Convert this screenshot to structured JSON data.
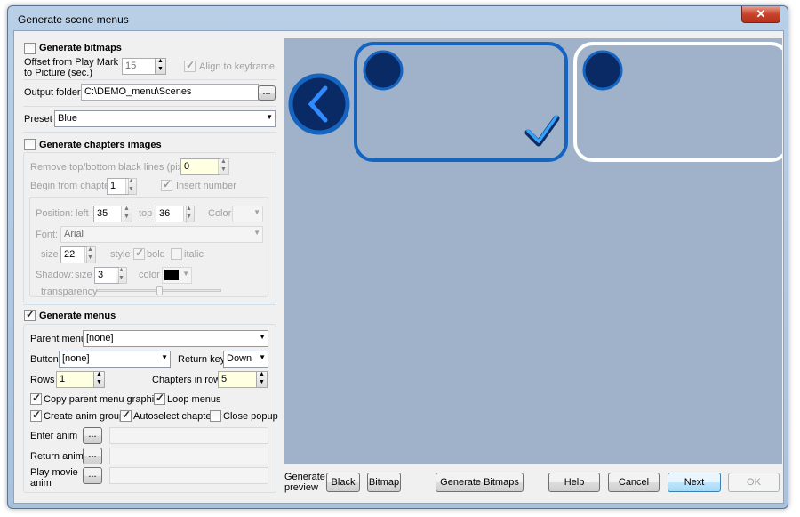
{
  "window": {
    "title": "Generate scene menus",
    "close_glyph": "✕"
  },
  "bitmaps": {
    "label": "Generate bitmaps",
    "checked": false,
    "offset_label": "Offset from Play Mark to Picture (sec.)",
    "offset_value": "15",
    "align_label": "Align to keyframe",
    "align_checked": true
  },
  "output": {
    "label": "Output folder",
    "value": "C:\\DEMO_menu\\Scenes",
    "browse": "..."
  },
  "preset": {
    "label": "Preset",
    "value": "Blue"
  },
  "chapters": {
    "label": "Generate chapters images",
    "checked": false,
    "remove_label": "Remove top/bottom black lines (pixels)",
    "remove_value": "0",
    "begin_label": "Begin from chapter",
    "begin_value": "1",
    "insert_label": "Insert number",
    "insert_checked": true,
    "position_label": "Position:",
    "left_label": "left",
    "left_value": "35",
    "top_label": "top",
    "top_value": "36",
    "color_label": "Color",
    "font_label": "Font:",
    "font_value": "Arial",
    "size_label": "size",
    "size_value": "22",
    "style_label": "style",
    "bold_label": "bold",
    "bold_checked": true,
    "italic_label": "italic",
    "italic_checked": false,
    "shadow_label": "Shadow:",
    "shadow_size_label": "size",
    "shadow_size_value": "3",
    "shadow_color_label": "color",
    "shadow_color": "#000000",
    "transparency_label": "transparency",
    "transparency_level": 0.5
  },
  "menus": {
    "label": "Generate menus",
    "checked": true,
    "parent_label": "Parent menu",
    "parent_value": "[none]",
    "button_label": "Button",
    "button_value": "[none]",
    "return_label": "Return key",
    "return_value": "Down",
    "rows_label": "Rows",
    "rows_value": "1",
    "chapters_row_label": "Chapters in row",
    "chapters_row_value": "5",
    "copy_label": "Copy parent menu graphics",
    "copy_checked": true,
    "loop_label": "Loop menus",
    "loop_checked": true,
    "anim_group_label": "Create anim group",
    "anim_group_checked": true,
    "autoselect_label": "Autoselect chapter",
    "autoselect_checked": true,
    "close_popup_label": "Close popup",
    "close_popup_checked": false,
    "enter_anim_label": "Enter anim",
    "return_anim_label": "Return anim",
    "play_movie_label": "Play movie anim",
    "browse": "..."
  },
  "footer": {
    "preview_label": "Generate preview",
    "black": "Black",
    "bitmap": "Bitmap",
    "gen_bitmaps": "Generate Bitmaps",
    "help": "Help",
    "cancel": "Cancel",
    "next": "Next",
    "ok": "OK"
  },
  "colors": {
    "preview_bg": "#a0b2c9",
    "selected_frame": "#1565c0",
    "normal_frame": "#ffffff",
    "circle_fill": "#0a2a66"
  },
  "icons": {
    "back": "chevron-left-icon",
    "check": "checkmark-icon"
  }
}
